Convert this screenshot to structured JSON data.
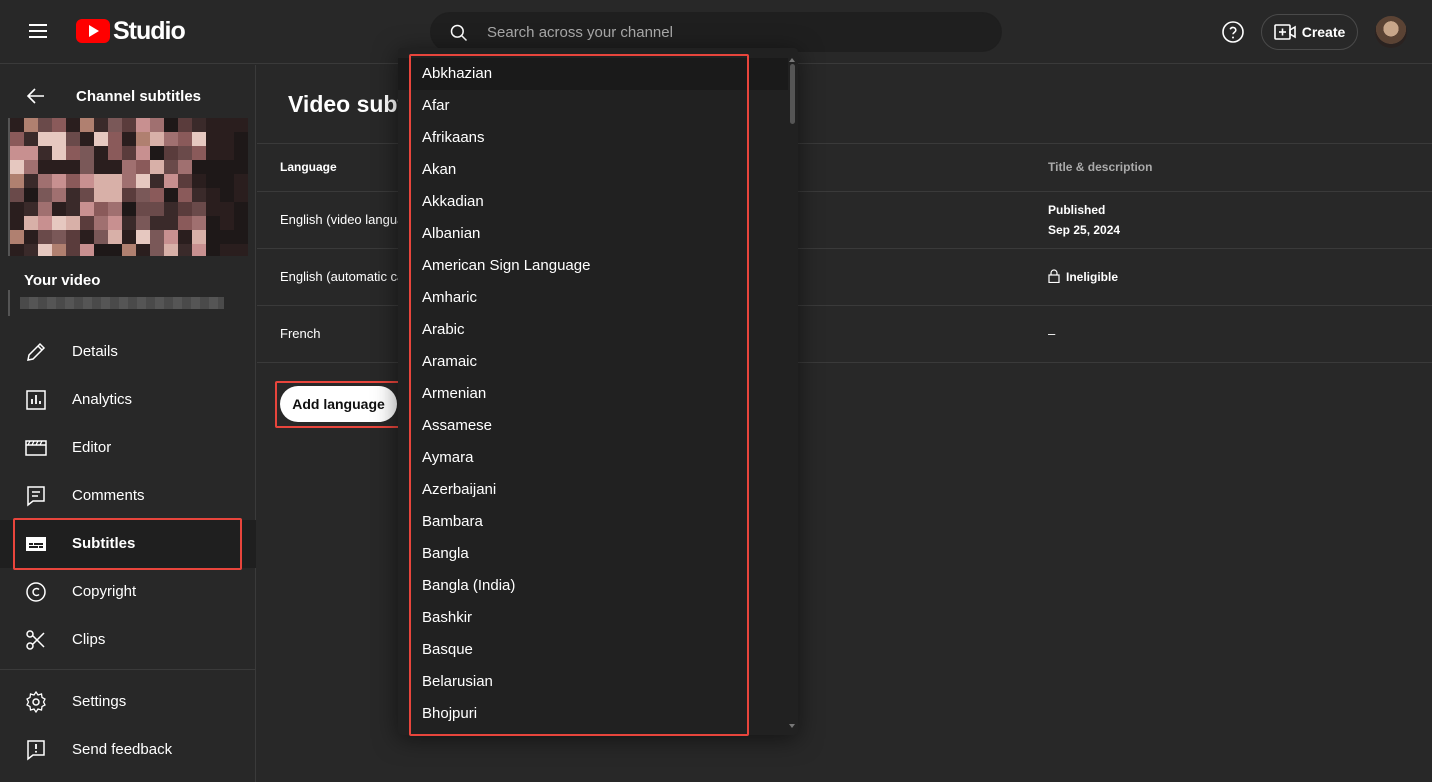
{
  "header": {
    "logo_text": "Studio",
    "search_placeholder": "Search across your channel",
    "create_label": "Create"
  },
  "sidebar": {
    "back_label": "Channel subtitles",
    "your_video_label": "Your video",
    "nav": [
      {
        "label": "Details",
        "icon": "pencil-icon"
      },
      {
        "label": "Analytics",
        "icon": "analytics-icon"
      },
      {
        "label": "Editor",
        "icon": "clapperboard-icon"
      },
      {
        "label": "Comments",
        "icon": "comment-icon"
      },
      {
        "label": "Subtitles",
        "icon": "subtitles-icon",
        "active": true
      },
      {
        "label": "Copyright",
        "icon": "copyright-icon"
      },
      {
        "label": "Clips",
        "icon": "scissors-icon"
      }
    ],
    "footer": [
      {
        "label": "Settings",
        "icon": "gear-icon"
      },
      {
        "label": "Send feedback",
        "icon": "feedback-icon"
      }
    ]
  },
  "main": {
    "title": "Video subtitles",
    "columns": {
      "language": "Language",
      "title_description": "Title & description"
    },
    "rows": [
      {
        "language": "English (video language)",
        "title_status": "Published",
        "title_date": "Sep 25, 2024"
      },
      {
        "language": "English (automatic captions)",
        "title_status": "Ineligible"
      },
      {
        "language": "French",
        "title_status": "–"
      }
    ],
    "add_language_label": "Add language"
  },
  "language_dropdown": {
    "items": [
      "Abkhazian",
      "Afar",
      "Afrikaans",
      "Akan",
      "Akkadian",
      "Albanian",
      "American Sign Language",
      "Amharic",
      "Arabic",
      "Aramaic",
      "Armenian",
      "Assamese",
      "Aymara",
      "Azerbaijani",
      "Bambara",
      "Bangla",
      "Bangla (India)",
      "Bashkir",
      "Basque",
      "Belarusian",
      "Bhojpuri"
    ]
  },
  "colors": {
    "accent_red": "#ff0000",
    "highlight": "#e8453c",
    "background": "#282828"
  }
}
